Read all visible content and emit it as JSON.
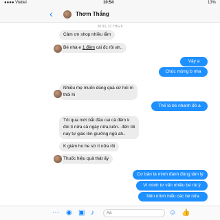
{
  "status": {
    "carrier": "●●●● Viettel",
    "time": "10:54",
    "battery": "13%"
  },
  "chat": {
    "contact_name": "Thơm Thắng",
    "timestamp": "20:33, 21 THG 8"
  },
  "messages": {
    "m1": "Cảm ơn shop nhiều lắm",
    "m2a": "Bé nhà e ",
    "m2b": "1 đêm",
    "m2c": " cái đc rồi ah..",
    "m3": "Vậy a",
    "m4": "Chúc mừng b nha",
    "m5a": "Nhiều mẹ muốn dùng quá cứ hỏi m",
    "m5b": "thôi hi",
    "m6": "Thế là bé nhanh đó a",
    "m7a": "Tối qua mới bắt đầu cai cả đêm k",
    "m7b": "đòi tí nữa cả ngày nữa,luôn.. đến tối",
    "m7c": "nay tự giác lên giường ngủ ah..",
    "m8": "K giám ho he sờ tí nữa rồi",
    "m9": "Thuốc hiệu quả thật ấy",
    "m10": "Cơ bản là mình đánh đúng tâm lý",
    "m11": "Vì mình tư vấn nhiều bé rùi ý",
    "m12": "Nên mình hiểu các bé nữa"
  },
  "composer": {
    "placeholder": "Aa"
  },
  "colors": {
    "accent": "#0a84ff",
    "outgoing_bubble": "#1e90ff",
    "incoming_bubble": "#ececec"
  }
}
